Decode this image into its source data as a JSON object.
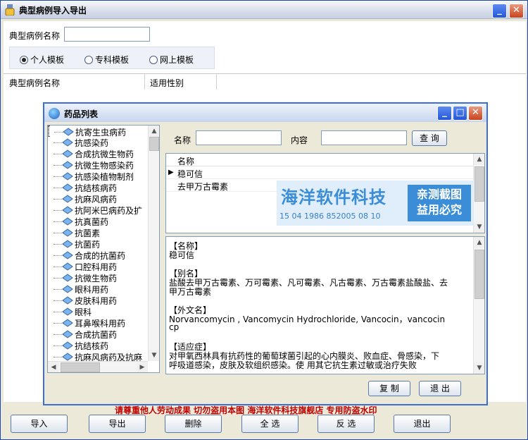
{
  "window": {
    "title": "典型病例导入导出"
  },
  "form": {
    "case_name_label": "典型病例名称",
    "case_name_value": "",
    "radios": [
      {
        "label": "个人模板",
        "selected": true
      },
      {
        "label": "专科模板",
        "selected": false
      },
      {
        "label": "网上模板",
        "selected": false
      }
    ]
  },
  "main_grid": {
    "columns": [
      "典型病例名称",
      "适用性别"
    ]
  },
  "dialog": {
    "title": "药品列表",
    "tree_items": [
      "抗寄生虫病药",
      "抗感染药",
      "合成抗微生物药",
      "抗微生物感染药",
      "抗感染植物制剂",
      "抗结核病药",
      "抗麻风病药",
      "抗阿米巴病药及扩",
      "抗真菌药",
      "抗菌素",
      "抗菌药",
      "合成的抗菌药",
      "口腔科用药",
      "抗微生物药",
      "眼科用药",
      "皮肤科用药",
      "眼科",
      "耳鼻喉科用药",
      "合成抗菌药",
      "抗结核药",
      "抗麻风病药及抗麻"
    ],
    "search": {
      "name_label": "名称",
      "name_value": "",
      "content_label": "内容",
      "content_value": "",
      "query_button": "查 询"
    },
    "list": {
      "header": "名称",
      "rows": [
        "稳可信",
        "去甲万古霉素"
      ],
      "selected_index": 0
    },
    "detail_lines": [
      "【名称】",
      "稳可信",
      "",
      "【别名】",
      "盐酸去甲万古霉素、万可霉素、凡可霉素、凡古霉素、万古霉素盐酸盐、去",
      "甲万古霉素",
      "",
      "【外文名】",
      "  Norvancomycin , Vancomycin Hydrochloride, Vancocin，vancocin",
      "cp",
      "",
      "【适应症】",
      " 对甲氧西林具有抗药性的葡萄球菌引起的心内膜炎、败血症、骨感染，下",
      "呼吸道感染，皮肤及软组织感染。使        用其它抗生素过敏或治疗失败"
    ],
    "copy_button": "复 制",
    "exit_button": "退 出"
  },
  "watermark": {
    "main": "海洋软件科技",
    "numbers": "15 04 1986 852005 08 10",
    "box_line1": "亲测截图",
    "box_line2": "益用必究"
  },
  "footer_notice": "请尊重他人劳动成果   切勿盗用本图   海洋软件科技旗舰店   专用防盗水印",
  "bottom_buttons": [
    "导入",
    "导出",
    "删除",
    "全 选",
    "反 选",
    "退出"
  ],
  "colors": {
    "title_blue": "#2556d9",
    "close_red": "#c8431d",
    "notice_red": "#c00000"
  }
}
